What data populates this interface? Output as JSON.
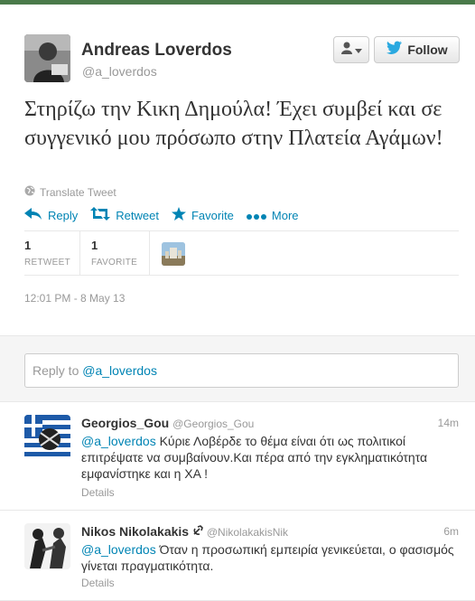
{
  "tweet": {
    "author_name": "Andreas Loverdos",
    "author_handle": "@a_loverdos",
    "text": "Στηρίζω την Κικη Δημούλα! Έχει συμβεί και σε συγγενικό μου πρόσωπο στην Πλατεία Αγάμων!",
    "translate_label": "Translate Tweet",
    "actions": {
      "reply": "Reply",
      "retweet": "Retweet",
      "favorite": "Favorite",
      "more": "More"
    },
    "stats": {
      "retweets_count": "1",
      "retweets_label": "RETWEET",
      "favorites_count": "1",
      "favorites_label": "FAVORITE"
    },
    "timestamp": "12:01 PM - 8 May 13",
    "follow_label": "Follow"
  },
  "reply_box": {
    "prefix": "Reply to ",
    "mention": "@a_loverdos"
  },
  "replies": [
    {
      "name": "Georgios_Gou",
      "handle": "@Georgios_Gou",
      "time": "14m",
      "mention": "@a_loverdos",
      "text": " Κύριε Λοβέρδε το θέμα είναι ότι ως πολιτικοί επιτρέψατε να συμβαίνουν.Και πέρα από την εγκληματικότητα εμφανίστηκε και η ΧΑ !",
      "details": "Details"
    },
    {
      "name": "Nikos Nikolakakis",
      "handle": "@NikolakakisNik",
      "time": "6m",
      "mention": "@a_loverdos",
      "text": " Όταν η προσωπική εμπειρία γενικεύεται, ο φασισμός γίνεται πραγματικότητα.",
      "details": "Details"
    }
  ],
  "colors": {
    "link": "#0084b4",
    "muted": "#999999",
    "top_bar": "#4a7a4a",
    "twitter_bird": "#2aa9e0"
  }
}
